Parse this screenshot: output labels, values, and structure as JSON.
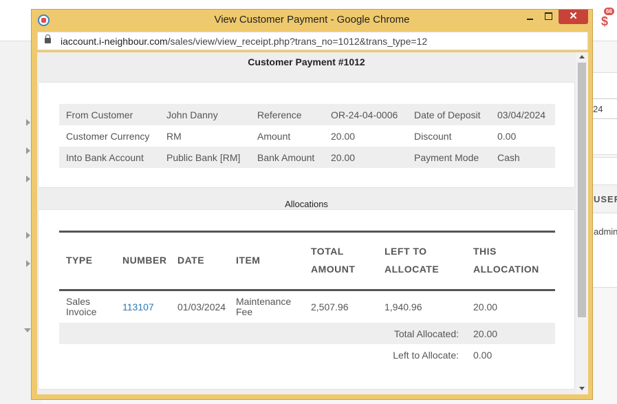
{
  "background": {
    "date_field": "24",
    "user_header": "USER",
    "user_cell": "admin",
    "notification_count": "66"
  },
  "window": {
    "title": "View Customer Payment - Google Chrome",
    "close_glyph": "✕",
    "url_host": "iaccount.i-neighbour.com",
    "url_path": "/sales/view/view_receipt.php?trans_no=1012&trans_type=12"
  },
  "receipt": {
    "heading": "Customer Payment #1012",
    "rows": [
      [
        "From Customer",
        "John Danny",
        "Reference",
        "OR-24-04-0006",
        "Date of Deposit",
        "03/04/2024"
      ],
      [
        "Customer Currency",
        "RM",
        "Amount",
        "20.00",
        "Discount",
        "0.00"
      ],
      [
        "Into Bank Account",
        "Public Bank [RM]",
        "Bank Amount",
        "20.00",
        "Payment Mode",
        "Cash"
      ]
    ]
  },
  "allocations": {
    "caption": "Allocations",
    "headers": {
      "type": "TYPE",
      "number": "NUMBER",
      "date": "DATE",
      "item": "ITEM",
      "total_1": "TOTAL",
      "total_2": "AMOUNT",
      "left_1": "LEFT TO",
      "left_2": "ALLOCATE",
      "this_1": "THIS",
      "this_2": "ALLOCATION"
    },
    "row": {
      "type_1": "Sales",
      "type_2": "Invoice",
      "number": "113107",
      "date": "01/03/2024",
      "item_1": "Maintenance",
      "item_2": "Fee",
      "total_amount": "2,507.96",
      "left_to_allocate": "1,940.96",
      "this_allocation": "20.00"
    },
    "total_allocated_label": "Total Allocated:",
    "total_allocated_value": "20.00",
    "left_to_allocate_label": "Left to Allocate:",
    "left_to_allocate_value": "0.00"
  },
  "colors": {
    "window_frame": "#efc96d",
    "close_button": "#c7433a",
    "link": "#2a7ab8"
  }
}
